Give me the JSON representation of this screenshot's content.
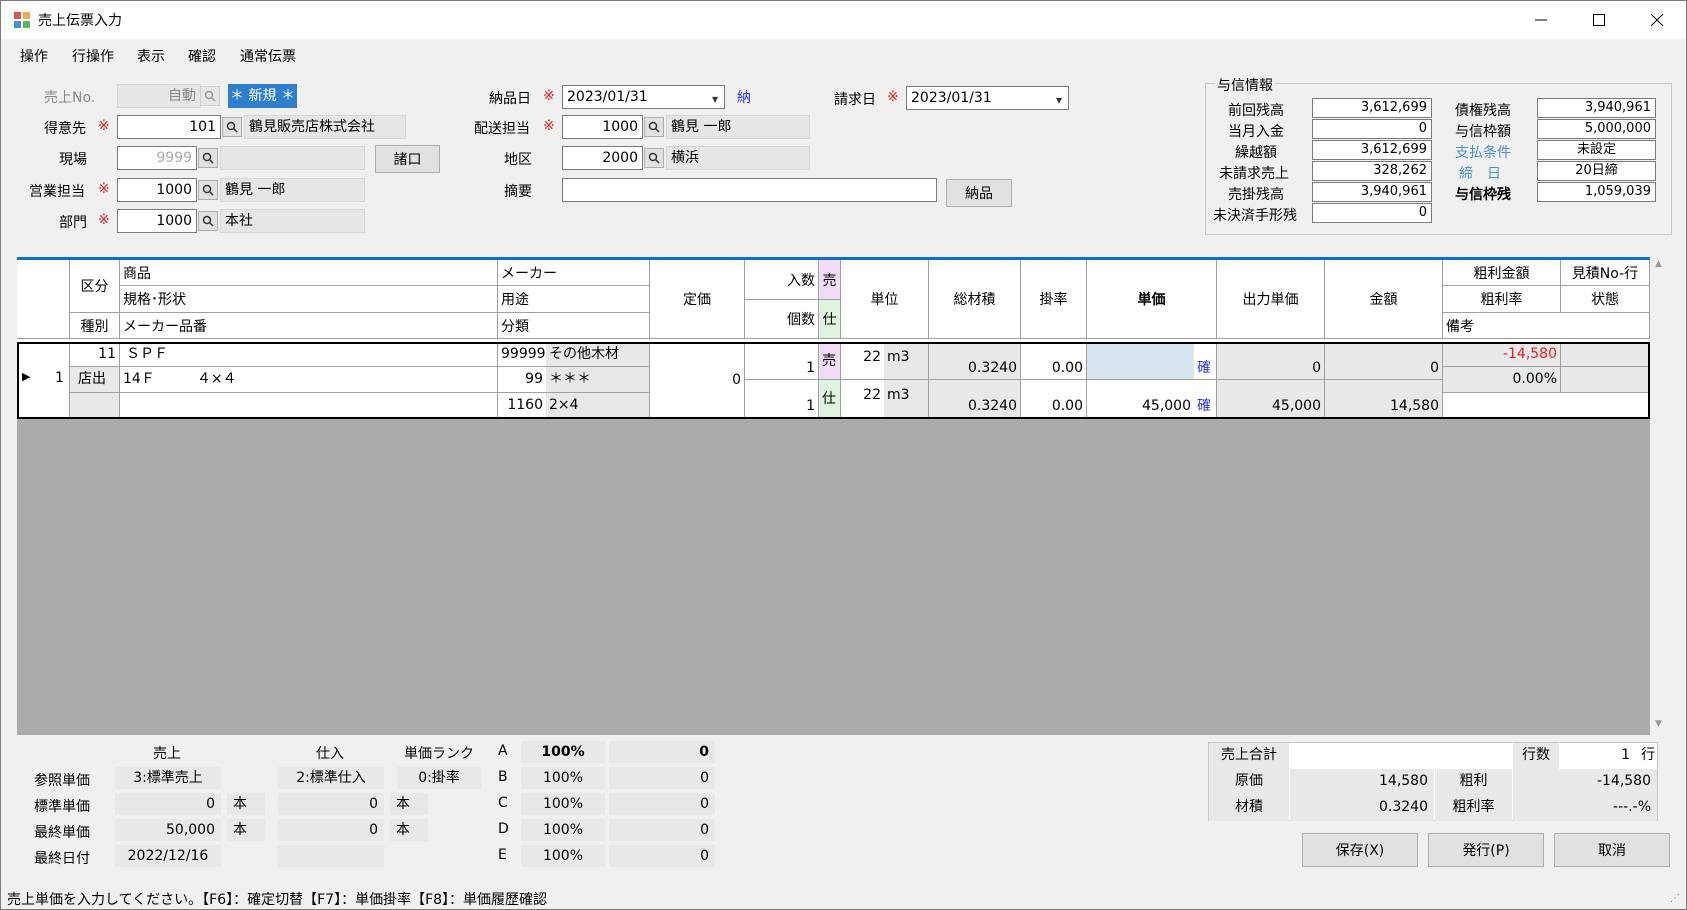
{
  "window": {
    "title": "売上伝票入力"
  },
  "menu": [
    "操作",
    "行操作",
    "表示",
    "確認",
    "通常伝票"
  ],
  "header": {
    "sale_no_label": "売上No.",
    "sale_no_value": "自動",
    "new_badge": "＊ 新規 ＊",
    "customer_label": "得意先",
    "customer_code": "101",
    "customer_name": "鶴見販売店株式会社",
    "site_label": "現場",
    "site_code": "9999",
    "misc_button": "諸口",
    "sales_rep_label": "営業担当",
    "sales_rep_code": "1000",
    "sales_rep_name": "鶴見 一郎",
    "dept_label": "部門",
    "dept_code": "1000",
    "dept_name": "本社",
    "delivery_date_label": "納品日",
    "delivery_date": "2023/01/31",
    "delivery_mark": "納",
    "shipper_label": "配送担当",
    "shipper_code": "1000",
    "shipper_name": "鶴見 一郎",
    "area_label": "地区",
    "area_code": "2000",
    "area_name": "横浜",
    "summary_label": "摘要",
    "summary_value": "",
    "deliver_button": "納品",
    "billing_date_label": "請求日",
    "billing_date": "2023/01/31",
    "required_mark": "※"
  },
  "credit": {
    "title": "与信情報",
    "left": [
      {
        "label": "前回残高",
        "value": "3,612,699"
      },
      {
        "label": "当月入金",
        "value": "0"
      },
      {
        "label": "繰越額",
        "value": "3,612,699"
      },
      {
        "label": "未請求売上",
        "value": "328,262"
      },
      {
        "label": "売掛残高",
        "value": "3,940,961"
      },
      {
        "label": "未決済手形残",
        "value": "0"
      }
    ],
    "right": [
      {
        "label": "債権残高",
        "value": "3,940,961"
      },
      {
        "label": "与信枠額",
        "value": "5,000,000"
      },
      {
        "label": "支払条件",
        "value": "未設定"
      },
      {
        "label": "締　日",
        "value": "20日締"
      },
      {
        "label": "与信枠残",
        "value": "1,059,039"
      }
    ]
  },
  "grid": {
    "headers": {
      "kubun": "区分",
      "shubetsu": "種別",
      "shohin": "商品",
      "kikaku": "規格･形状",
      "maker_hinban": "メーカー品番",
      "maker": "メーカー",
      "youto": "用途",
      "bunrui": "分類",
      "teika": "定価",
      "irisu": "入数",
      "kosu": "個数",
      "uri": "売",
      "shi": "仕",
      "tani": "単位",
      "sozaiseki": "総材積",
      "kakeritsu": "掛率",
      "tanka": "単価",
      "shutsuryoku": "出力単価",
      "kingaku": "金額",
      "arari_kingaku": "粗利金額",
      "arari_ritsu": "粗利率",
      "biko": "備考",
      "mitsumori": "見積No-行",
      "jotai": "状態"
    },
    "row": {
      "row_no": "1",
      "kubun_code": "11",
      "kubun_name": "店出",
      "product": "ＳＰＦ",
      "spec": "14Ｆ　　　４×４",
      "maker_code": "99999",
      "maker_name": "その他木材",
      "use_code": "99",
      "use_name": "＊＊＊",
      "class_code": "1160",
      "class_name": "2×4",
      "list_price": "0",
      "sale_qty_per": "1",
      "purchase_qty_per": "1",
      "uri_mark": "売",
      "shi_mark": "仕",
      "sale_unit_qty": "22",
      "sale_unit": "m3",
      "purchase_unit_qty": "22",
      "purchase_unit": "m3",
      "sale_volume": "0.3240",
      "purchase_volume": "0.3240",
      "sale_rate": "0.00",
      "purchase_rate": "0.00",
      "sale_price": "",
      "purchase_price": "45,000",
      "confirm_mark": "確",
      "sale_output_price": "0",
      "purchase_output_price": "45,000",
      "sale_amount": "0",
      "purchase_amount": "14,580",
      "gross_profit": "-14,580",
      "gross_rate": "0.00%"
    }
  },
  "bottom": {
    "col_sale": "売上",
    "col_purchase": "仕入",
    "col_rank": "単価ランク",
    "ref_price_label": "参照単価",
    "ref_sale": "3:標準売上",
    "ref_purchase": "2:標準仕入",
    "ref_rank": "0:掛率",
    "std_price_label": "標準単価",
    "std_sale": "0",
    "std_purchase": "0",
    "last_price_label": "最終単価",
    "last_sale": "50,000",
    "last_purchase": "0",
    "unit_hon": "本",
    "last_date_label": "最終日付",
    "last_date": "2022/12/16",
    "ranks": [
      {
        "rank": "A",
        "pct": "100%",
        "value": "0"
      },
      {
        "rank": "B",
        "pct": "100%",
        "value": "0"
      },
      {
        "rank": "C",
        "pct": "100%",
        "value": "0"
      },
      {
        "rank": "D",
        "pct": "100%",
        "value": "0"
      },
      {
        "rank": "E",
        "pct": "100%",
        "value": "0"
      }
    ]
  },
  "totals": {
    "sales_total_label": "売上合計",
    "sales_total": "",
    "line_count_label": "行数",
    "line_count": "1",
    "line_unit": "行",
    "cost_label": "原価",
    "cost": "14,580",
    "profit_label": "粗利",
    "profit": "-14,580",
    "volume_label": "材積",
    "volume": "0.3240",
    "profit_rate_label": "粗利率",
    "profit_rate": "---.-%"
  },
  "buttons": {
    "save": "保存(X)",
    "issue": "発行(P)",
    "cancel": "取消"
  },
  "status": "売上単価を入力してください。【F6】：確定切替【F7】：単価掛率【F8】：単価履歴確認"
}
